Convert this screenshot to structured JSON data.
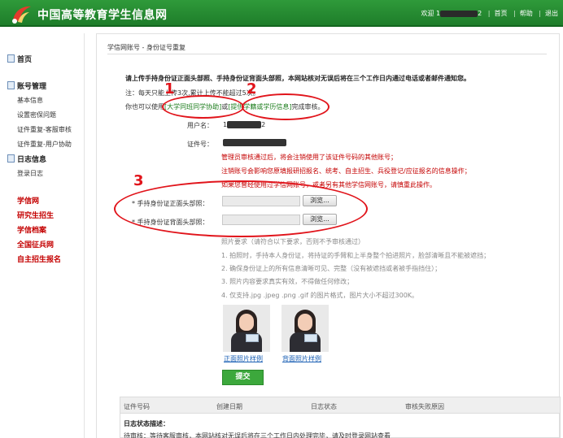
{
  "header": {
    "site_title": "中国高等教育学生信息网",
    "welcome_prefix": "欢迎 1",
    "welcome_suffix": "2",
    "nav": [
      "首页",
      "帮助",
      "退出"
    ]
  },
  "sidebar": {
    "home": "首页",
    "account_section": "账号管理",
    "account_items": [
      "基本信息",
      "设置密保问题",
      "证件重复-客服审核",
      "证件重复-用户协助"
    ],
    "log_section": "日志信息",
    "log_items": [
      "登录日志"
    ],
    "red_links": [
      "学信网",
      "研究生招生",
      "学信档案",
      "全国征兵网",
      "自主招生报名"
    ]
  },
  "main": {
    "breadcrumb": "学信网账号 - 身份证号重复",
    "instruction": "请上传手持身份证正面头部照、手持身份证背面头部照，本网站核对无误后将在三个工作日内通过电话或者邮件通知您。",
    "note_prefix": "注：每天只能上传3次,累计上传不能超过5次。",
    "alt_prefix": "你也可以使用",
    "alt_link1": "[大学同班同学协助]",
    "alt_or": "或",
    "alt_link2": "[提供学籍或学历信息]",
    "alt_suffix": "完成审核。",
    "username_label": "用户名：",
    "username_prefix": "1",
    "username_suffix": "2",
    "id_label": "证件号：",
    "warnings": [
      "管理员审核通过后，将会注销使用了该证件号码的其他账号；",
      "注销账号会影响您原填报研招报名、统考、自主招生、兵役登记/应征报名的信息操作；",
      "如果您曾经使用过学信网账号，或者另有其他学信网账号，请慎重此操作。"
    ],
    "upload_front_label": "* 手持身份证正面头部照：",
    "upload_back_label": "* 手持身份证背面头部照：",
    "browse_label": "浏览...",
    "requirements_title": "照片要求（请符合以下要求，否则不予审核通过）",
    "requirements": [
      "1. 拍照时，手持本人身份证，将持证的手臂和上半身整个拍进照片，脸部清晰且不能被遮挡；",
      "2. 确保身份证上的所有信息清晰可见、完整（没有被遮挡或者被手指挡住）；",
      "3. 照片内容要求真实有效，不得做任何修改；",
      "4. 仅支持.jpg .jpeg .png .gif 的图片格式，图片大小不超过300K。"
    ],
    "sample_front": "正面照片样例",
    "sample_back": "背面照片样例",
    "submit_label": "提交"
  },
  "log_table": {
    "headers": [
      "证件号码",
      "创建日期",
      "日志状态",
      "审核失败原因"
    ],
    "status_title": "日志状态描述：",
    "status_desc": "待审核：等待客服审核，本网站核对无误后将在三个工作日内处理完毕，请及时登录网站查看"
  },
  "annotations": [
    "1",
    "2",
    "3"
  ],
  "colors": {
    "header_green": "#1e7d2a",
    "accent_red": "#c40000",
    "annotation_red": "#e1141b",
    "submit_green": "#3ca83c"
  }
}
